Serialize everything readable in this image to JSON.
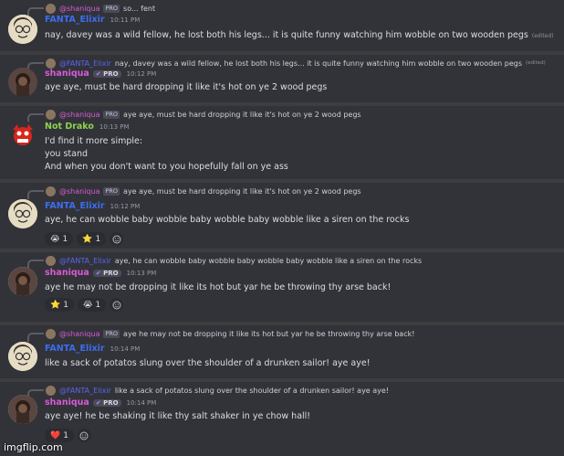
{
  "colors": {
    "blue_user": "#3c6df0",
    "shaniqua": "#d65bd6",
    "drako": "#8fd14f",
    "reply_link": "#5865f2"
  },
  "icons": {
    "pro_badge": "purple-check-icon",
    "add_reaction": "smiley-plus-icon"
  },
  "messages": [
    {
      "reply_user": "@shaniqua",
      "reply_tag": "PRO",
      "reply_text": "so... fent",
      "reply_edited": "",
      "user": "FANTA_Elixir",
      "tag": "",
      "time": "10:11 PM",
      "lines": [
        "nay, davey was a wild fellow, he lost both his legs... it is quite funny watching him wobble on two wooden pegs"
      ],
      "edited": "(edited)",
      "reactions": []
    },
    {
      "reply_user": "@FANTA_Elixir",
      "reply_tag": "",
      "reply_text": "nay, davey was a wild fellow, he lost both his legs... it is quite funny watching him wobble on two wooden pegs",
      "reply_edited": "(edited)",
      "user": "shaniqua",
      "tag": "PRO",
      "time": "10:12 PM",
      "lines": [
        "aye aye, must be hard dropping it like it's hot on ye 2 wood pegs"
      ],
      "edited": "",
      "reactions": []
    },
    {
      "reply_user": "@shaniqua",
      "reply_tag": "PRO",
      "reply_text": "aye aye, must be hard dropping it like it's hot on ye 2 wood pegs",
      "reply_edited": "",
      "user": "Not Drako",
      "tag": "",
      "time": "10:13 PM",
      "lines": [
        "I'd find it more simple:",
        "you stand",
        "And when you don't want to you hopefully fall on ye ass"
      ],
      "edited": "",
      "reactions": []
    },
    {
      "reply_user": "@shaniqua",
      "reply_tag": "PRO",
      "reply_text": "aye aye, must be hard dropping it like it's hot on ye 2 wood pegs",
      "reply_edited": "",
      "user": "FANTA_Elixir",
      "tag": "",
      "time": "10:12 PM",
      "lines": [
        "aye, he can wobble baby wobble baby wobble baby wobble like a siren on the rocks"
      ],
      "edited": "",
      "reactions": [
        {
          "emoji": "😭",
          "count": "1"
        },
        {
          "emoji": "⭐",
          "count": "1"
        }
      ]
    },
    {
      "reply_user": "@FANTA_Elixir",
      "reply_tag": "",
      "reply_text": "aye, he can wobble baby wobble baby wobble baby wobble like a siren on the rocks",
      "reply_edited": "",
      "user": "shaniqua",
      "tag": "PRO",
      "time": "10:13 PM",
      "lines": [
        "aye he may not be dropping it like its hot but yar he be throwing thy arse back!"
      ],
      "edited": "",
      "reactions": [
        {
          "emoji": "⭐",
          "count": "1"
        },
        {
          "emoji": "😭",
          "count": "1"
        }
      ]
    },
    {
      "reply_user": "@shaniqua",
      "reply_tag": "PRO",
      "reply_text": "aye he may not be dropping it like its hot but yar he be throwing thy arse back!",
      "reply_edited": "",
      "user": "FANTA_Elixir",
      "tag": "",
      "time": "10:14 PM",
      "lines": [
        "like a sack of potatos slung over the shoulder of a drunken sailor! aye aye!"
      ],
      "edited": "",
      "reactions": []
    },
    {
      "reply_user": "@FANTA_Elixir",
      "reply_tag": "",
      "reply_text": "like a sack of potatos slung over the shoulder of a drunken sailor! aye aye!",
      "reply_edited": "",
      "user": "shaniqua",
      "tag": "PRO",
      "time": "10:14 PM",
      "lines": [
        "aye aye! he be shaking it like thy salt shaker in ye chow hall!"
      ],
      "edited": "",
      "reactions": [
        {
          "emoji": "❤️",
          "count": "1"
        }
      ]
    }
  ],
  "watermark": "imgflip.com"
}
